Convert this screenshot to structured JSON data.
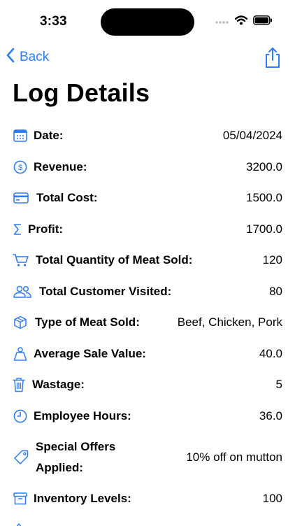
{
  "status_bar": {
    "time": "3:33"
  },
  "nav": {
    "back_label": "Back",
    "back_icon": "chevron-left-icon",
    "share_icon": "share-icon"
  },
  "title": "Log Details",
  "colors": {
    "accent": "#2f7cf6",
    "text": "#000000",
    "background": "#ffffff"
  },
  "rows": [
    {
      "icon": "calendar-icon",
      "label": "Date:",
      "value": "05/04/2024"
    },
    {
      "icon": "dollar-circle-icon",
      "label": "Revenue:",
      "value": "3200.0"
    },
    {
      "icon": "credit-card-icon",
      "label": "Total Cost:",
      "value": "1500.0"
    },
    {
      "icon": "sigma-icon",
      "label": "Profit:",
      "value": "1700.0"
    },
    {
      "icon": "cart-icon",
      "label": "Total Quantity of Meat Sold:",
      "value": "120"
    },
    {
      "icon": "people-icon",
      "label": "Total Customer Visited:",
      "value": "80"
    },
    {
      "icon": "cube-icon",
      "label": "Type of Meat Sold:",
      "value": "Beef, Chicken, Pork"
    },
    {
      "icon": "scale-icon",
      "label": "Average Sale Value:",
      "value": "40.0"
    },
    {
      "icon": "trash-icon",
      "label": "Wastage:",
      "value": "5"
    },
    {
      "icon": "clock-icon",
      "label": "Employee Hours:",
      "value": "36.0"
    },
    {
      "icon": "tag-icon",
      "label": "Special Offers Applied:",
      "value": "10% off on mutton"
    },
    {
      "icon": "archive-box-icon",
      "label": "Inventory Levels:",
      "value": "100"
    }
  ]
}
